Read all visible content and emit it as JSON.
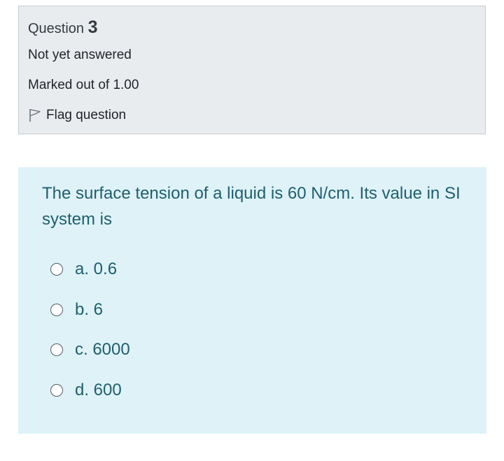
{
  "question_info": {
    "prefix": "Question",
    "number": "3",
    "state": "Not yet answered",
    "grade": "Marked out of 1.00",
    "flag_label": "Flag question",
    "flag_icon": "flag-outline-icon"
  },
  "question": {
    "text": "The surface tension of a liquid is 60 N/cm. Its value in SI system is",
    "answers": [
      {
        "label": "a. 0.6",
        "selected": false
      },
      {
        "label": "b. 6",
        "selected": false
      },
      {
        "label": "c. 6000",
        "selected": false
      },
      {
        "label": "d. 600",
        "selected": false
      }
    ]
  },
  "colors": {
    "info_background": "#e9ecef",
    "question_background": "#def2f8",
    "question_text": "#1f5f6f"
  }
}
